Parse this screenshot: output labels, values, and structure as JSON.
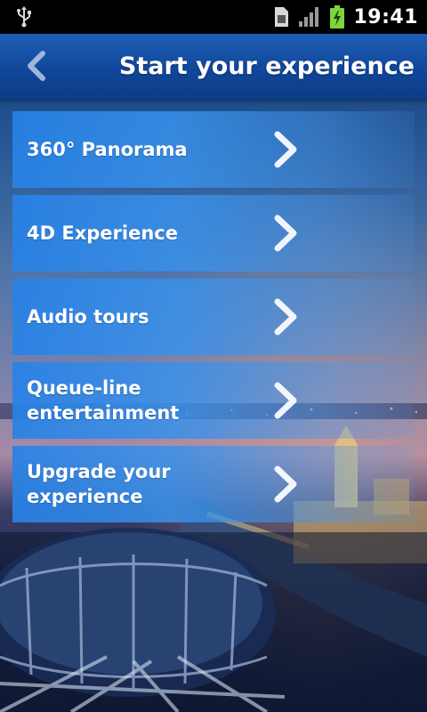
{
  "status_bar": {
    "time": "19:41",
    "icons": [
      "usb-icon",
      "sim-card-icon",
      "signal-icon",
      "battery-charging-icon"
    ]
  },
  "header": {
    "title": "Start your experience",
    "back_icon": "back-chevron-icon"
  },
  "menu": {
    "items": [
      {
        "label": "360° Panorama"
      },
      {
        "label": "4D Experience"
      },
      {
        "label": "Audio tours"
      },
      {
        "label": "Queue-line entertainment"
      },
      {
        "label": "Upgrade your experience"
      }
    ]
  },
  "colors": {
    "header": "#10479a",
    "menu_item": "#2882e6",
    "text": "#ffffff"
  }
}
